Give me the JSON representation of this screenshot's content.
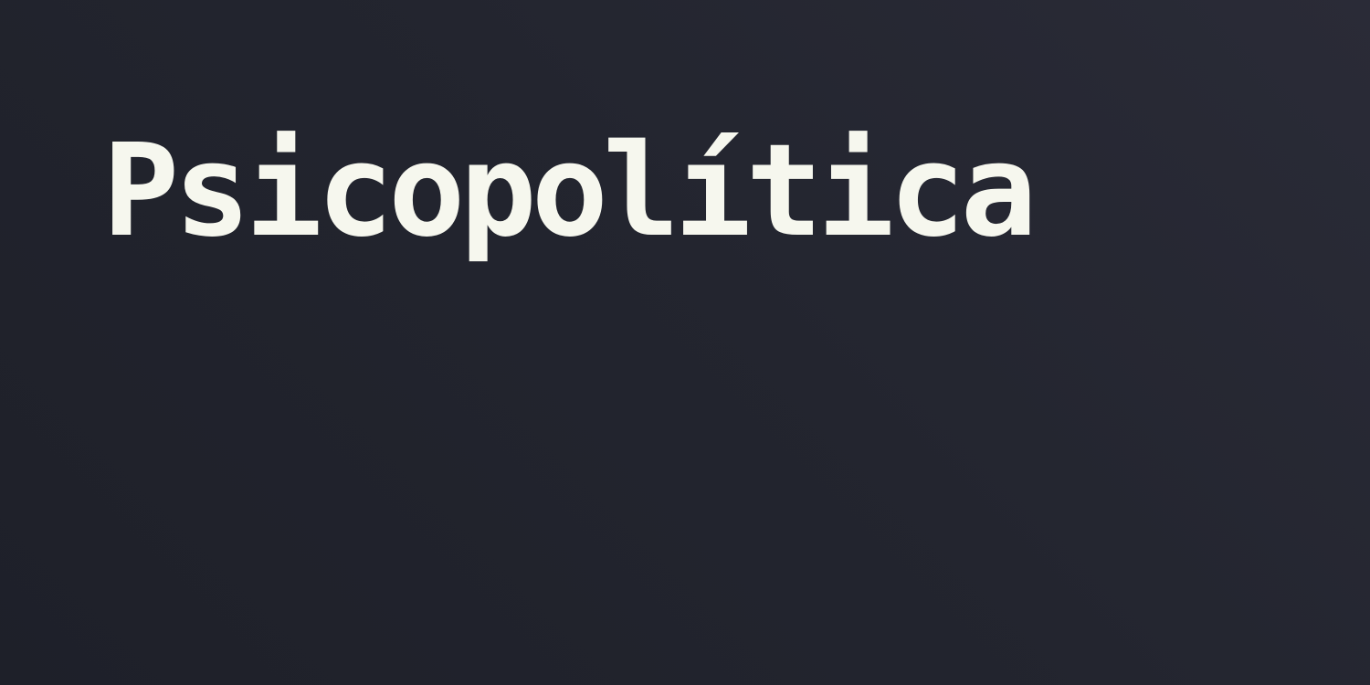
{
  "title": "Psicopolítica",
  "colors": {
    "background": "#23252f",
    "title_text": "#f6f7ee"
  }
}
